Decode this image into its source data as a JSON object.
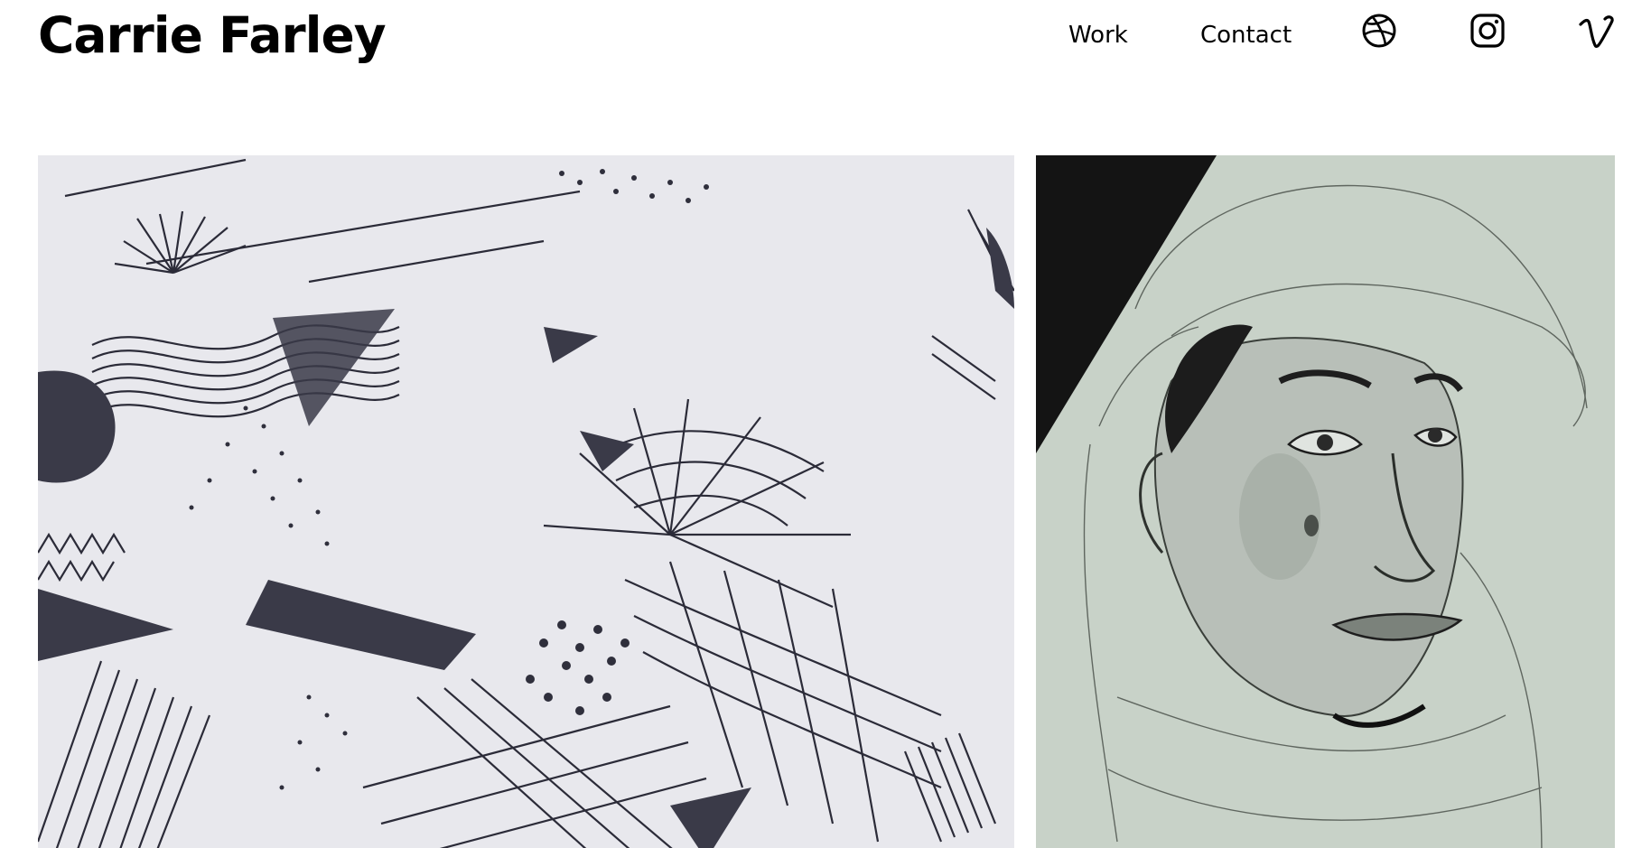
{
  "site": {
    "title": "Carrie Farley"
  },
  "nav": {
    "items": [
      {
        "label": "Work"
      },
      {
        "label": "Contact"
      }
    ],
    "social": [
      {
        "icon": "dribbble-icon"
      },
      {
        "icon": "instagram-icon"
      },
      {
        "icon": "vimeo-icon"
      }
    ]
  },
  "gallery": {
    "items": [
      {
        "subject": "abstract pen pattern drawing"
      },
      {
        "subject": "pencil portrait drawing"
      }
    ]
  }
}
